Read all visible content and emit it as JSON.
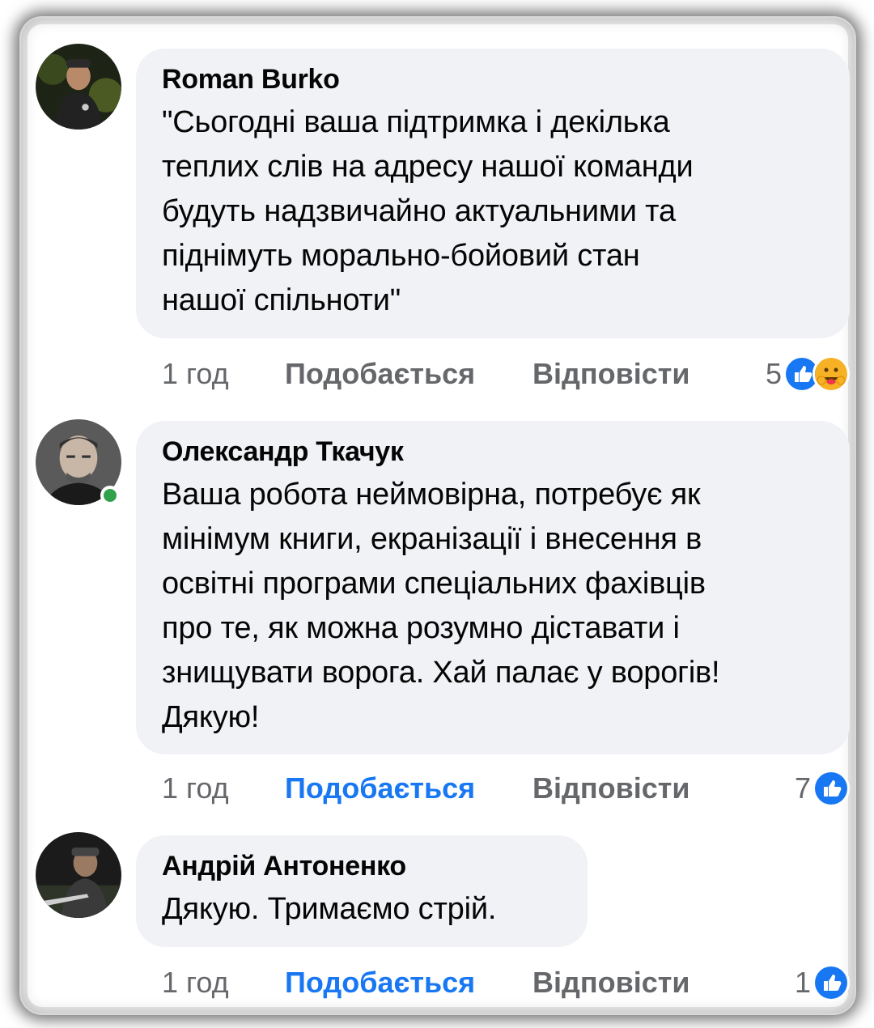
{
  "comments": [
    {
      "author": "Roman Burko",
      "text": "\"Сьогодні ваша підтримка і декілька\nтеплих слів на адресу нашої команди\nбудуть надзвичайно актуальними та\nпіднімуть морально-бойовий стан\nнашої спільноти\"",
      "time": "1 год",
      "like_label": "Подобається",
      "like_active": false,
      "reply_label": "Відповісти",
      "reaction_count": "5",
      "reaction_icons": [
        "like-icon",
        "care-icon"
      ],
      "online": false
    },
    {
      "author": "Олександр Ткачук",
      "text": "Ваша робота неймовірна, потребує як\nмінімум книги, екранізації і внесення в\nосвітні програми спеціальних фахівців\nпро те, як можна розумно діставати і\nзнищувати ворога. Хай палає у ворогів!\nДякую!",
      "time": "1 год",
      "like_label": "Подобається",
      "like_active": true,
      "reply_label": "Відповісти",
      "reaction_count": "7",
      "reaction_icons": [
        "like-icon"
      ],
      "online": true
    },
    {
      "author": "Андрій Антоненко",
      "text": "Дякую. Тримаємо стрій.",
      "time": "1 год",
      "like_label": "Подобається",
      "like_active": true,
      "reply_label": "Відповісти",
      "reaction_count": "1",
      "reaction_icons": [
        "like-icon"
      ],
      "online": false
    }
  ],
  "colors": {
    "bubble": "#f0f2f5",
    "text": "#050505",
    "meta": "#65676b",
    "like_active": "#1877f2",
    "online": "#31a24c"
  }
}
